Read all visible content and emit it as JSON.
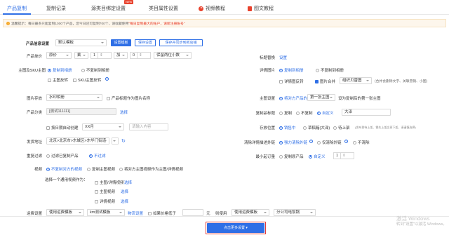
{
  "tabs": [
    {
      "label": "产品复制"
    },
    {
      "label": "复制记录"
    },
    {
      "label": "源类目绑定设置",
      "badge": "NEW"
    },
    {
      "label": "类目属性设置"
    },
    {
      "label": "视频教程"
    },
    {
      "label": "图文教程"
    }
  ],
  "tip": {
    "prefix": "温馨提示：每日最多只能复制1000个产品，您今日还可复制700个，请收藏使用",
    "highlight": "\"每日复制最大的账户，请新注册账号\"",
    "icon": "warning-icon"
  },
  "template": {
    "label": "产品信息设置",
    "value": "默认模板",
    "btn_set": "设置模板",
    "btn_save": "保存设置",
    "btn_save_sync": "保存并同步到新店铺"
  },
  "price": {
    "label": "产品单价",
    "mode": "原价",
    "op1": "乘",
    "v1": "1",
    "op2": "加",
    "v2": "0",
    "decimal": "保留两位小数"
  },
  "sku": {
    "label": "主图及SKU主图",
    "opt_copy": "复制到相册",
    "opt_nocopy": "不复制到相册",
    "opt_flip": "主图反转",
    "opt_sku_flip": "SKU主图反转"
  },
  "img_storage": {
    "label": "图片存放",
    "value": "水印相册",
    "hint": "产品标题作为图片名称"
  },
  "category": {
    "label": "产品分类",
    "value": "[测试111111]",
    "link": "选择"
  },
  "schedule": {
    "label": "",
    "opt": "按日期自动创建",
    "value": "XX月",
    "placeholder": "请输入内容"
  },
  "ship_from": {
    "label": "发货地址",
    "value": "北京>北京市>东城区>东华门街道"
  },
  "dedupe": {
    "label": "重复过滤",
    "opt1": "过滤已复制产品",
    "opt2": "不过滤"
  },
  "video": {
    "label": "视频",
    "opt1": "不复制对方的视频",
    "opt2": "复制主图视频",
    "opt3": "将对方主图视频作为主图/详情视频",
    "sub_label": "选择一个通用视频作为：",
    "choices": [
      {
        "label": "主图/详情视频",
        "link": "选择"
      },
      {
        "label": "主图视频",
        "link": "选择"
      },
      {
        "label": "详情视频",
        "link": "选择"
      }
    ]
  },
  "freight": {
    "label": "运费设置",
    "v1": "使用运费模板",
    "v2": "km测试模板",
    "link": "物流设置",
    "cb": "如果价格低于",
    "unit": "元",
    "then": "则使用",
    "v3": "使用运费模板",
    "v4": "分公司电饭锅"
  },
  "right": {
    "title_repl": {
      "label": "标题替换",
      "link": "设置"
    },
    "detail_img": {
      "label": "详情图片",
      "opt1": "复制到相册",
      "opt2": "不复制到相册",
      "cb1": "详情图反转",
      "cb2": "图片合并",
      "select": "组织贝雷图",
      "hint": "(合并会删除文字、关联营销、小图)"
    },
    "main_img": {
      "label": "主图设置",
      "opt1": "将对方产品的",
      "select": "第一张主图",
      "opt2": "设为复制后的第一张主图"
    },
    "copy_title": {
      "label": "复制品标题",
      "opt1": "复制",
      "opt2": "不复制",
      "opt3": "自定义",
      "value": "大泽"
    },
    "stock": {
      "label": "存放位置",
      "opt1": "销售中",
      "opt2": "草稿箱(大泽)",
      "opt3": "待上架",
      "hint": "(发布到待上架、需先上架店再下架，请谨慎选择)"
    },
    "clear": {
      "label": "清除详情描述外链",
      "opt1": "强力清除外链",
      "opt2": "仅清除外链",
      "opt3": "不清除"
    },
    "min_order": {
      "label": "最小起订量",
      "opt1": "复制原产品",
      "opt2": "自定义",
      "value": "1"
    }
  },
  "footer": {
    "button": "点击更多设置",
    "watermark_big": "激活 Windows",
    "watermark_small": "转到\"设置\"以激活 Windows。"
  },
  "colors": {
    "accent": "#2f6fe6",
    "red": "#e8412c"
  }
}
